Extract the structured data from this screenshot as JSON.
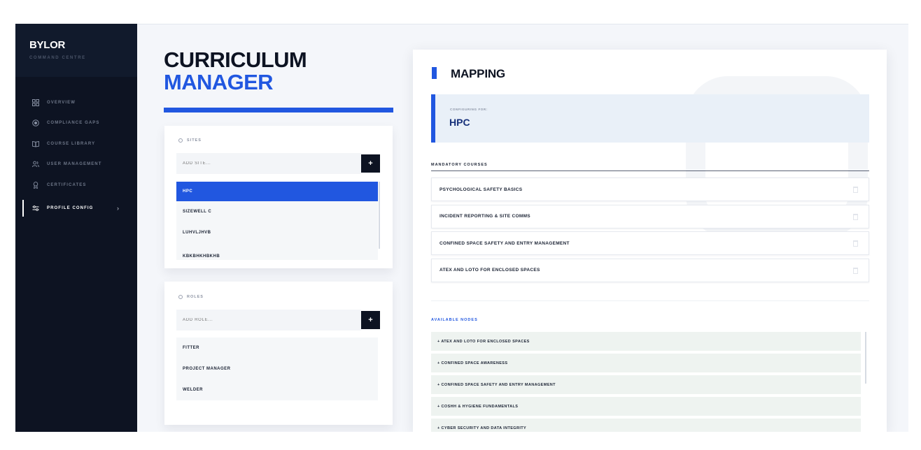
{
  "sidebar": {
    "brand": "BYLOR",
    "brand_sub": "COMMAND CENTRE",
    "items": [
      {
        "label": "OVERVIEW",
        "icon": "grid-icon"
      },
      {
        "label": "COMPLIANCE GAPS",
        "icon": "target-icon"
      },
      {
        "label": "COURSE LIBRARY",
        "icon": "book-icon"
      },
      {
        "label": "USER MANAGEMENT",
        "icon": "users-icon"
      },
      {
        "label": "CERTIFICATES",
        "icon": "award-icon"
      },
      {
        "label": "PROFILE CONFIG",
        "icon": "sliders-icon",
        "active": true
      }
    ],
    "chevron": "›"
  },
  "page": {
    "title_line1": "CURRICULUM",
    "title_line2": "MANAGER"
  },
  "sites": {
    "label": "SITES",
    "placeholder": "ADD SITE...",
    "add_label": "+",
    "items": [
      "HPC",
      "SIZEWELL C",
      "LUHVLJHVB",
      "KBKBHKHBKHB"
    ],
    "selected": "HPC"
  },
  "roles": {
    "label": "ROLES",
    "placeholder": "ADD ROLE...",
    "add_label": "+",
    "items": [
      "FITTER",
      "PROJECT MANAGER",
      "WELDER"
    ]
  },
  "mapping": {
    "title": "MAPPING",
    "config_label": "CONFIGURING FOR:",
    "config_value": "HPC",
    "mandatory_heading": "MANDATORY COURSES",
    "mandatory": [
      "PSYCHOLOGICAL SAFETY BASICS",
      "INCIDENT REPORTING & SITE COMMS",
      "CONFINED SPACE SAFETY AND ENTRY MANAGEMENT",
      "ATEX AND LOTO FOR ENCLOSED SPACES"
    ],
    "available_heading": "AVAILABLE NODES",
    "available": [
      "+ ATEX AND LOTO FOR ENCLOSED SPACES",
      "+ CONFINED SPACE AWARENESS",
      "+ CONFINED SPACE SAFETY AND ENTRY MANAGEMENT",
      "+ COSHH & HYGIENE FUNDAMENTALS",
      "+ CYBER SECURITY AND DATA INTEGRITY"
    ]
  },
  "colors": {
    "accent": "#2157e0",
    "sidebar_bg": "#0d1322",
    "page_bg": "#f4f6fa"
  }
}
